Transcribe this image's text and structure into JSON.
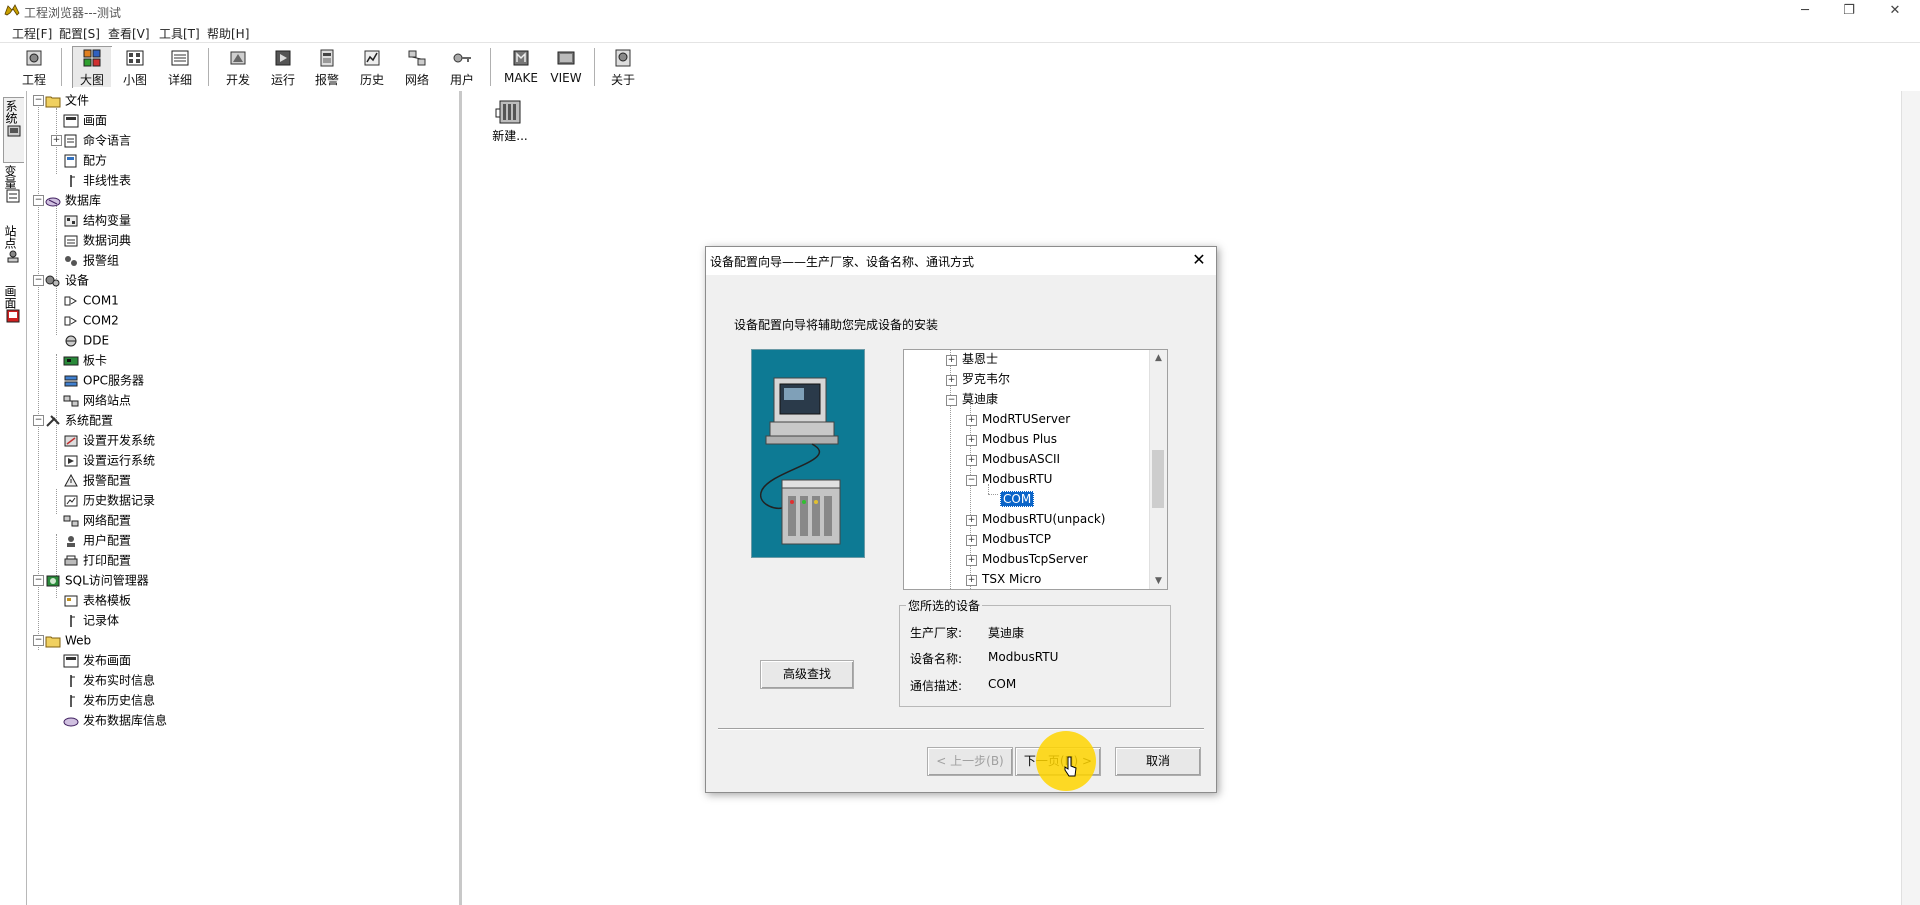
{
  "window": {
    "title": "工程浏览器---测试",
    "controls": [
      "─",
      "❐",
      "✕"
    ]
  },
  "menu": [
    "工程[F]",
    "配置[S]",
    "查看[V]",
    "工具[T]",
    "帮助[H]"
  ],
  "toolbar": {
    "items": [
      {
        "label": "工程",
        "icon": "project-icon"
      },
      {
        "label": "大图",
        "icon": "large-icons-icon"
      },
      {
        "label": "小图",
        "icon": "small-icons-icon"
      },
      {
        "label": "详细",
        "icon": "details-icon"
      },
      {
        "label": "开发",
        "icon": "develop-icon"
      },
      {
        "label": "运行",
        "icon": "run-icon"
      },
      {
        "label": "报警",
        "icon": "alarm-icon"
      },
      {
        "label": "历史",
        "icon": "history-icon"
      },
      {
        "label": "网络",
        "icon": "network-icon"
      },
      {
        "label": "用户",
        "icon": "user-key-icon"
      },
      {
        "label": "MAKE",
        "icon": "make-icon"
      },
      {
        "label": "VIEW",
        "icon": "view-icon"
      },
      {
        "label": "关于",
        "icon": "about-icon"
      }
    ]
  },
  "vtabs": [
    "系统",
    "变量",
    "站点",
    "画面"
  ],
  "tree": {
    "groups": [
      {
        "label": "文件",
        "children": [
          "画面",
          "命令语言",
          "配方",
          "非线性表"
        ]
      },
      {
        "label": "数据库",
        "children": [
          "结构变量",
          "数据词典",
          "报警组"
        ]
      },
      {
        "label": "设备",
        "children": [
          "COM1",
          "COM2",
          "DDE",
          "板卡",
          "OPC服务器",
          "网络站点"
        ]
      },
      {
        "label": "系统配置",
        "children": [
          "设置开发系统",
          "设置运行系统",
          "报警配置",
          "历史数据记录",
          "网络配置",
          "用户配置",
          "打印配置"
        ]
      },
      {
        "label": "SQL访问管理器",
        "children": [
          "表格模板",
          "记录体"
        ]
      },
      {
        "label": "Web",
        "children": [
          "发布画面",
          "发布实时信息",
          "发布历史信息",
          "发布数据库信息"
        ]
      }
    ]
  },
  "right_pane": {
    "new_item_label": "新建..."
  },
  "dialog": {
    "title": "设备配置向导——生产厂家、设备名称、通讯方式",
    "intro": "设备配置向导将辅助您完成设备的安装",
    "device_tree": [
      {
        "label": "基恩士",
        "level": 0,
        "expander": "+"
      },
      {
        "label": "罗克韦尔",
        "level": 0,
        "expander": "+"
      },
      {
        "label": "莫迪康",
        "level": 0,
        "expander": "−"
      },
      {
        "label": "ModRTUServer",
        "level": 1,
        "expander": "+"
      },
      {
        "label": "Modbus Plus",
        "level": 1,
        "expander": "+"
      },
      {
        "label": "ModbusASCII",
        "level": 1,
        "expander": "+"
      },
      {
        "label": "ModbusRTU",
        "level": 1,
        "expander": "−"
      },
      {
        "label": "COM",
        "level": 2,
        "expander": "",
        "selected": true
      },
      {
        "label": "ModbusRTU(unpack)",
        "level": 1,
        "expander": "+"
      },
      {
        "label": "ModbusTCP",
        "level": 1,
        "expander": "+"
      },
      {
        "label": "ModbusTcpServer",
        "level": 1,
        "expander": "+"
      },
      {
        "label": "TSX Micro",
        "level": 1,
        "expander": "+"
      }
    ],
    "selected_group_label": "您所选的设备",
    "manufacturer_label": "生产厂家:",
    "manufacturer_value": "莫迪康",
    "device_name_label": "设备名称:",
    "device_name_value": "ModbusRTU",
    "comm_label": "通信描述:",
    "comm_value": "COM",
    "advanced_search": "高级查找",
    "prev_button": "< 上一步(B)",
    "next_button": "下一页(N) >",
    "cancel_button": "取消",
    "accent_color": "#0a64c8"
  }
}
